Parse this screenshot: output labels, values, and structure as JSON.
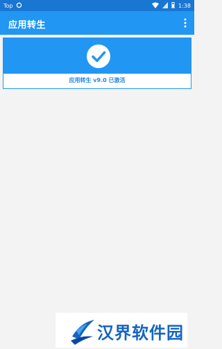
{
  "status_bar": {
    "carrier": "Top",
    "time": "1:38",
    "icons": [
      "sync-icon",
      "wifi-icon",
      "signal-icon",
      "battery-icon"
    ]
  },
  "app_bar": {
    "title": "应用转生",
    "menu_icon": "more-vert-icon"
  },
  "status_card": {
    "icon": "check-circle-icon",
    "text": "应用转生 v9.0 已激活"
  },
  "watermark": {
    "text": "汉界软件园",
    "logo": "watermark-logo"
  },
  "colors": {
    "primary": "#2196f3",
    "primary_dark": "#1976d2",
    "background": "#f3f3f3",
    "accent_text": "#1e88e5"
  }
}
